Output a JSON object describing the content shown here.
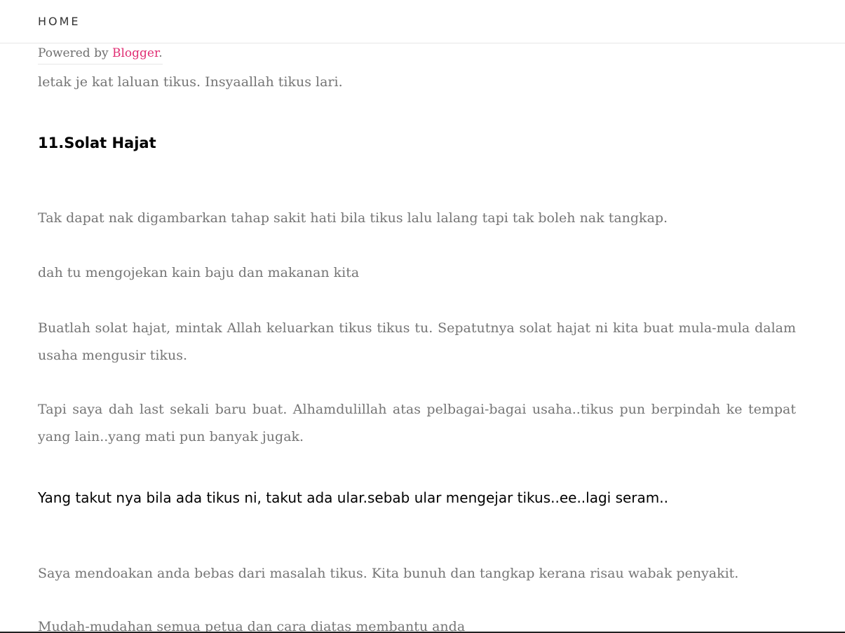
{
  "nav": {
    "home_label": "HOME"
  },
  "footer": {
    "powered_by_text": "Powered by ",
    "blogger_link": "Blogger",
    "period": "."
  },
  "article": {
    "paragraphs": [
      "letak je kat laluan tikus. Insyaallah tikus lari.",
      "Tak dapat nak digambarkan tahap sakit hati bila tikus lalu lalang tapi tak boleh nak tangkap.",
      "dah tu mengojekan kain baju dan makanan kita",
      "Buatlah solat hajat, mintak Allah keluarkan tikus tikus tu. Sepatutnya solat hajat ni kita buat mula-mula dalam usaha mengusir tikus.",
      "Tapi saya dah last sekali baru buat. Alhamdulillah atas pelbagai-bagai usaha..tikus pun berpindah ke tempat yang lain..yang mati pun banyak jugak.",
      "Saya mendoakan anda bebas dari masalah tikus. Kita bunuh dan tangkap kerana risau wabak penyakit.",
      "Mudah-mudahan semua petua dan cara diatas membantu anda"
    ],
    "heading": "11.Solat Hajat",
    "dark_line": "Yang takut nya bila ada tikus ni, takut ada ular.sebab ular mengejar tikus..ee..lagi seram.."
  },
  "colors": {
    "body_text": "#757575",
    "link_pink": "#e02e73",
    "heading_text": "#000000"
  }
}
